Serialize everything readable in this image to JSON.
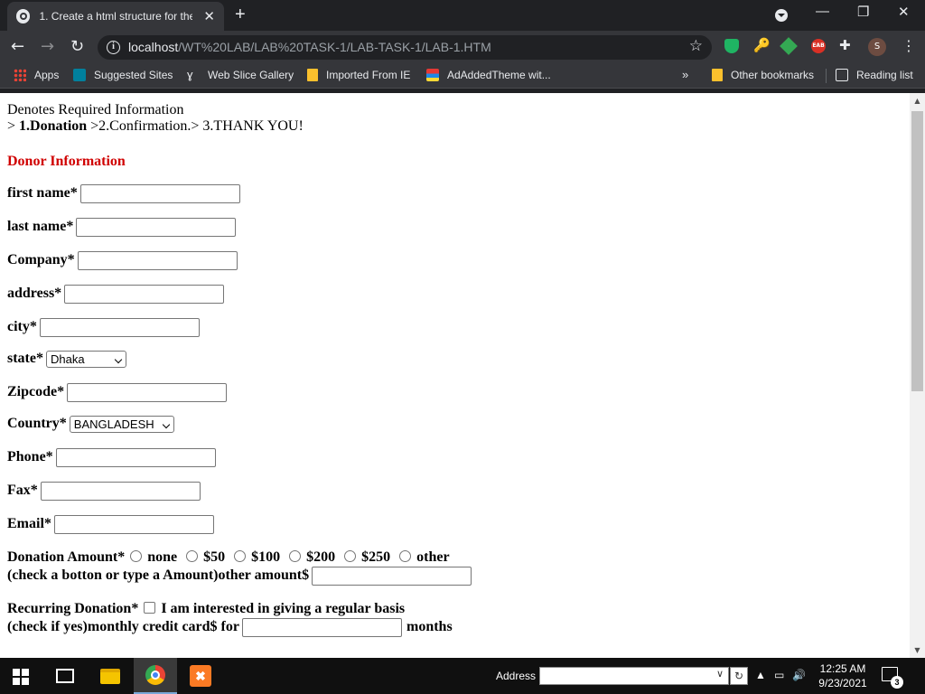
{
  "browser": {
    "tab_title": "1. Create a html structure for the",
    "url_host": "localhost",
    "url_path": "/WT%20LAB/LAB%20TASK-1/LAB-TASK-1/LAB-1.HTM",
    "profile_initial": "S",
    "bookmarks": {
      "apps": "Apps",
      "suggested": "Suggested Sites",
      "web_slice": "Web Slice Gallery",
      "imported": "Imported From IE",
      "theme": "AdAddedTheme wit...",
      "overflow": "»",
      "other": "Other bookmarks",
      "reading": "Reading list"
    }
  },
  "page": {
    "required_note": "Denotes Required Information",
    "steps": {
      "prefix": "> ",
      "step1": "1.Donation",
      "rest": " >2.Confirmation.> 3.THANK YOU!"
    },
    "section_title": "Donor Information",
    "fields": {
      "first_name": "first name*",
      "last_name": "last name*",
      "company": "Company*",
      "address": "address*",
      "city": "city*",
      "state": "state*",
      "zipcode": "Zipcode*",
      "country": "Country*",
      "phone": "Phone*",
      "fax": "Fax*",
      "email": "Email*"
    },
    "state_selected": "Dhaka",
    "country_selected": "BANGLADESH",
    "donation": {
      "label": "Donation Amount*",
      "options": [
        "none",
        "$50",
        "$100",
        "$200",
        "$250",
        "other"
      ],
      "hint": "(check a botton or type a Amount)other amount$"
    },
    "recurring": {
      "label": "Recurring Donation*",
      "checkbox_text": "I am interested in giving a regular basis",
      "hint": "(check if yes)monthly credit card$ for",
      "suffix": "months"
    }
  },
  "taskbar": {
    "address_label": "Address",
    "time": "12:25 AM",
    "date": "9/23/2021",
    "notification_count": "3"
  }
}
